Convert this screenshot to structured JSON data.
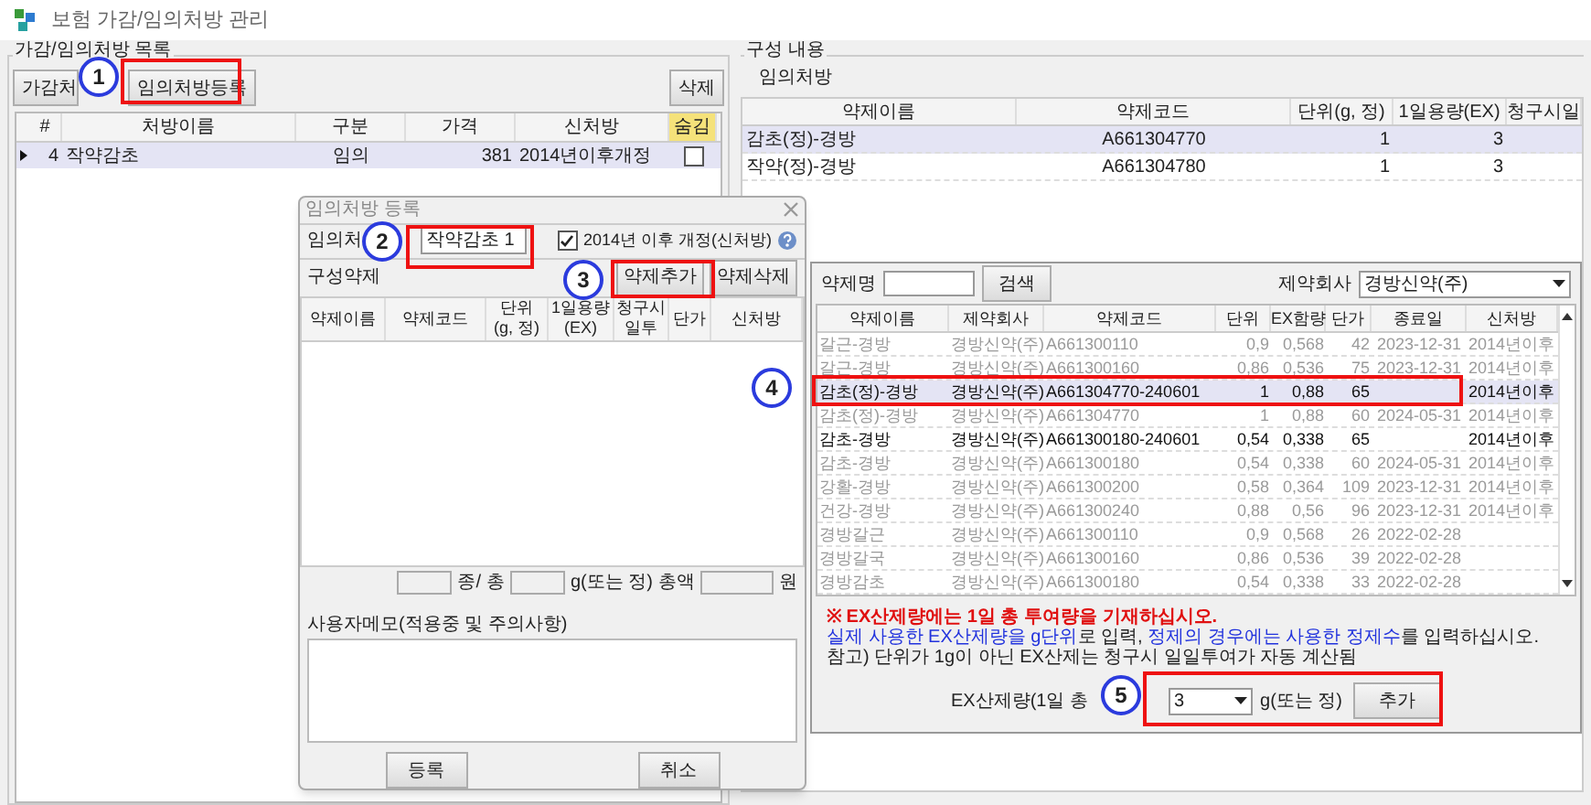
{
  "window": {
    "title": "보험 가감/임의처방 관리"
  },
  "list_panel": {
    "legend": "가감/임의처방 목록",
    "add_button": "가감처",
    "custom_button": "임의처방등록",
    "delete_button": "삭제",
    "columns": [
      "#",
      "처방이름",
      "구분",
      "가격",
      "신처방",
      "숨김"
    ],
    "rows": [
      {
        "cells": [
          "4",
          "작약감초",
          "임의",
          "381",
          "2014년이후개정"
        ],
        "hidden": false,
        "selected": true
      }
    ]
  },
  "content_panel": {
    "legend": "구성 내용",
    "subtitle": "임의처방",
    "columns": [
      "약제이름",
      "약제코드",
      "단위(g, 정)",
      "1일용량(EX)",
      "청구시일"
    ],
    "rows": [
      {
        "cells": [
          "감초(정)-경방",
          "A661304770",
          "1",
          "3"
        ],
        "selected": true
      },
      {
        "cells": [
          "작약(정)-경방",
          "A661304780",
          "1",
          "3"
        ],
        "selected": false
      }
    ]
  },
  "register_dialog": {
    "title": "임의처방 등록",
    "name_label": "임의처",
    "name_value": "작약감초 1",
    "new_rx": {
      "label": "2014년 이후 개정(신처방)",
      "checked": true
    },
    "section": "구성약제",
    "add_button": "약제추가",
    "remove_button": "약제삭제",
    "columns": [
      "약제이름",
      "약제코드",
      "단위\n(g, 정)",
      "1일용량\n(EX)",
      "청구시\n일투",
      "단가",
      "신처방"
    ],
    "totals": [
      "종/",
      "총",
      "g(또는 정)",
      "총액",
      "원"
    ],
    "memo_label": "사용자메모(적용중 및 주의사항)",
    "ok_button": "등록",
    "cancel_button": "취소"
  },
  "search_dialog": {
    "name_label": "약제명",
    "search_button": "검색",
    "maker_label": "제약회사",
    "maker_value": "경방신약(주)",
    "columns": [
      "약제이름",
      "제약회사",
      "약제코드",
      "단위",
      "EX함량",
      "단가",
      "종료일",
      "신처방"
    ],
    "rows": [
      {
        "cells": [
          "갈근-경방",
          "경방신약(주)",
          "A661300110",
          "0,9",
          "0,568",
          "42",
          "2023-12-31",
          "2014년이후"
        ],
        "expired": true,
        "selected": false
      },
      {
        "cells": [
          "갈근-경방",
          "경방신약(주)",
          "A661300160",
          "0,86",
          "0,536",
          "75",
          "2023-12-31",
          "2014년이후"
        ],
        "expired": true,
        "selected": false
      },
      {
        "cells": [
          "감초(정)-경방",
          "경방신약(주)",
          "A661304770-240601",
          "1",
          "0,88",
          "65",
          "",
          "2014년이후"
        ],
        "expired": false,
        "selected": true
      },
      {
        "cells": [
          "감초(정)-경방",
          "경방신약(주)",
          "A661304770",
          "1",
          "0,88",
          "60",
          "2024-05-31",
          "2014년이후"
        ],
        "expired": true,
        "selected": false
      },
      {
        "cells": [
          "감초-경방",
          "경방신약(주)",
          "A661300180-240601",
          "0,54",
          "0,338",
          "65",
          "",
          "2014년이후"
        ],
        "expired": false,
        "selected": false
      },
      {
        "cells": [
          "감초-경방",
          "경방신약(주)",
          "A661300180",
          "0,54",
          "0,338",
          "60",
          "2024-05-31",
          "2014년이후"
        ],
        "expired": true,
        "selected": false
      },
      {
        "cells": [
          "강활-경방",
          "경방신약(주)",
          "A661300200",
          "0,58",
          "0,364",
          "109",
          "2023-12-31",
          "2014년이후"
        ],
        "expired": true,
        "selected": false
      },
      {
        "cells": [
          "건강-경방",
          "경방신약(주)",
          "A661300240",
          "0,88",
          "0,56",
          "96",
          "2023-12-31",
          "2014년이후"
        ],
        "expired": true,
        "selected": false
      },
      {
        "cells": [
          "경방갈근",
          "경방신약(주)",
          "A661300110",
          "0,9",
          "0,568",
          "26",
          "2022-02-28",
          ""
        ],
        "expired": true,
        "selected": false
      },
      {
        "cells": [
          "경방갈국",
          "경방신약(주)",
          "A661300160",
          "0,86",
          "0,536",
          "39",
          "2022-02-28",
          ""
        ],
        "expired": true,
        "selected": false
      },
      {
        "cells": [
          "경방감초",
          "경방신약(주)",
          "A661300180",
          "0,54",
          "0,338",
          "33",
          "2022-02-28",
          ""
        ],
        "expired": true,
        "selected": false
      }
    ],
    "notes": [
      {
        "kind": "warning",
        "parts": [
          {
            "text": "※ EX산제량에는 1일 총 투여량을 기재하십시오.",
            "emph": true
          }
        ]
      },
      {
        "kind": "info",
        "parts": [
          {
            "text": "실제 사용한 EX산제량을 g단위",
            "emph": true
          },
          {
            "text": "로 입력, ",
            "emph": false
          },
          {
            "text": "정제의 경우에는 사용한 정제수",
            "emph": true
          },
          {
            "text": "를 입력하십시오.",
            "emph": false
          }
        ]
      },
      {
        "kind": "plain",
        "parts": [
          {
            "text": "참고) 단위가 1g이 아닌 EX산제는 청구시 일일투여가 자동 계산됨",
            "emph": false
          }
        ]
      }
    ],
    "dose_label": "EX산제량(1일 총",
    "dose_value": "3",
    "dose_unit": "g(또는 정)",
    "add_button": "추가"
  },
  "annotations": [
    {
      "label": "1"
    },
    {
      "label": "2"
    },
    {
      "label": "3"
    },
    {
      "label": "4"
    },
    {
      "label": "5"
    }
  ]
}
